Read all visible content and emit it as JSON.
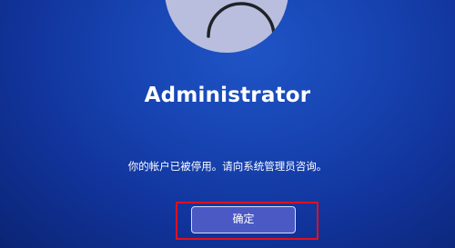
{
  "account": {
    "username": "Administrator",
    "avatar_icon": "user-avatar-icon"
  },
  "message": "你的帐户已被停用。请向系统管理员咨询。",
  "ok_button_label": "确定",
  "colors": {
    "background": "#1744b2",
    "avatar": "#b9bedf",
    "button": "#4b59c5",
    "highlight_box": "#e0101e"
  }
}
